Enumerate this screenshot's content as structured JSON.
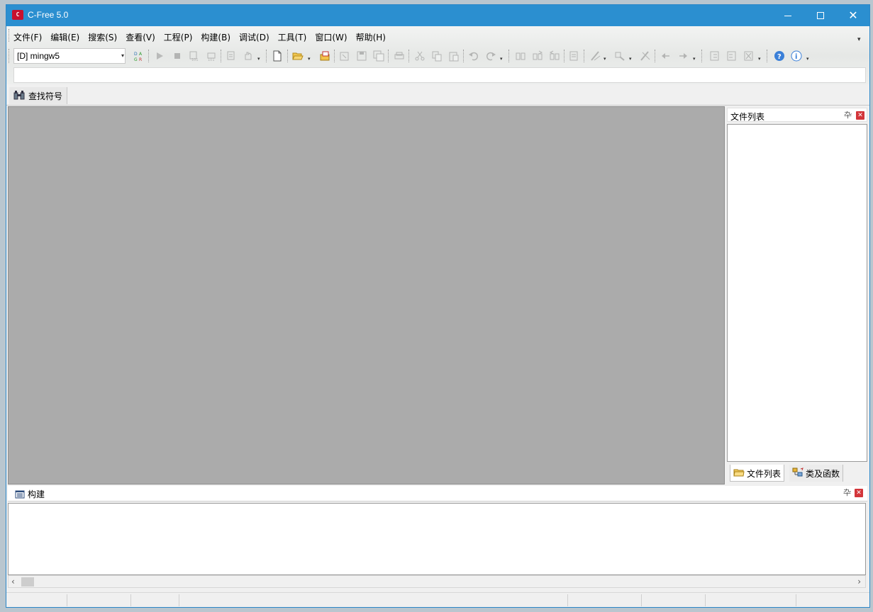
{
  "window": {
    "title": "C-Free 5.0",
    "app_icon": "C-Free logo",
    "app_icon_text": "C"
  },
  "menu": {
    "items": [
      {
        "label": "文件(F)"
      },
      {
        "label": "编辑(E)"
      },
      {
        "label": "搜索(S)"
      },
      {
        "label": "查看(V)"
      },
      {
        "label": "工程(P)"
      },
      {
        "label": "构建(B)"
      },
      {
        "label": "调试(D)"
      },
      {
        "label": "工具(T)"
      },
      {
        "label": "窗口(W)"
      },
      {
        "label": "帮助(H)"
      }
    ]
  },
  "toolbar": {
    "compiler_value": "[D] mingw5"
  },
  "find_tab": {
    "label": "查找符号"
  },
  "right_panel": {
    "title": "文件列表",
    "tabs": [
      {
        "label": "文件列表"
      },
      {
        "label": "类及函数"
      }
    ]
  },
  "build_panel": {
    "title": "构建"
  },
  "colors": {
    "titlebar": "#2b8fd0",
    "editor_bg": "#ababab",
    "close_red": "#d3353a"
  }
}
